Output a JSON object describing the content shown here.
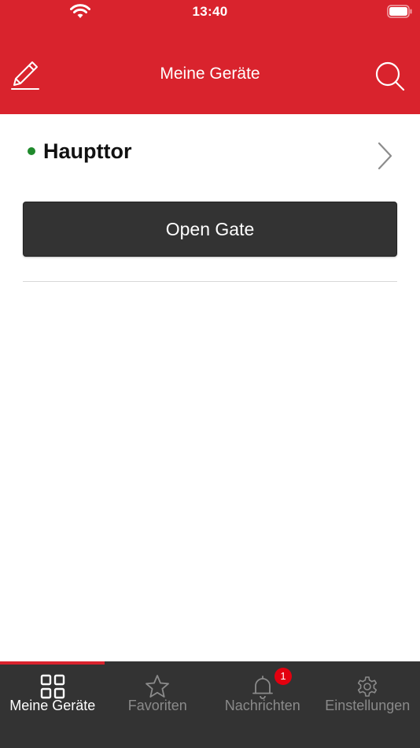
{
  "status_bar": {
    "time": "13:40",
    "icons": [
      "wifi-icon",
      "battery-icon"
    ]
  },
  "nav": {
    "title": "Meine Geräte",
    "left_icon": "edit-icon",
    "right_icon": "search-icon"
  },
  "device": {
    "name": "Haupttor",
    "status_color": "#1f8a2c",
    "action_label": "Open Gate"
  },
  "tabs": [
    {
      "label": "Meine Geräte",
      "icon": "grid-icon",
      "active": true
    },
    {
      "label": "Favoriten",
      "icon": "star-icon",
      "active": false
    },
    {
      "label": "Nachrichten",
      "icon": "bell-icon",
      "active": false,
      "badge": "1"
    },
    {
      "label": "Einstellungen",
      "icon": "gear-icon",
      "active": false
    }
  ],
  "colors": {
    "brand_red": "#d9232d",
    "dark_bg": "#333333",
    "badge_red": "#e3000f",
    "inactive_tab": "#8a8a8a"
  }
}
